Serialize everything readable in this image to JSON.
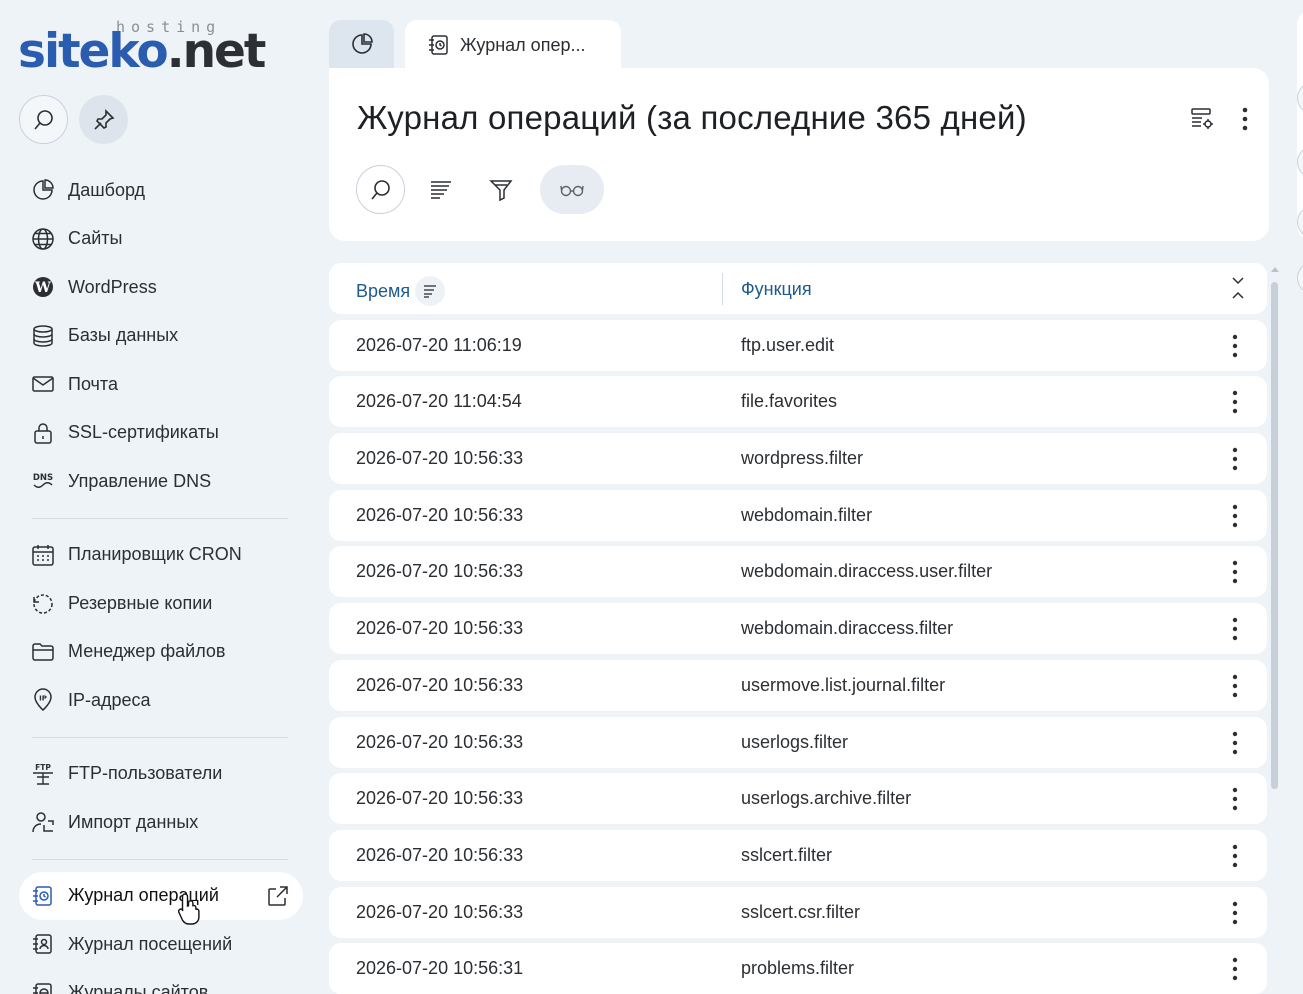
{
  "logo": {
    "hosting": "hosting",
    "brand_main": "siteko",
    "brand_tld": ".net"
  },
  "sidebar": {
    "groups": [
      [
        {
          "label": "Дашборд",
          "icon": "pie-chart-icon"
        },
        {
          "label": "Сайты",
          "icon": "globe-icon"
        },
        {
          "label": "WordPress",
          "icon": "wordpress-icon"
        },
        {
          "label": "Базы данных",
          "icon": "database-icon"
        },
        {
          "label": "Почта",
          "icon": "mail-icon"
        },
        {
          "label": "SSL-сертификаты",
          "icon": "lock-icon"
        },
        {
          "label": "Управление DNS",
          "icon": "dns-icon"
        }
      ],
      [
        {
          "label": "Планировщик CRON",
          "icon": "calendar-icon"
        },
        {
          "label": "Резервные копии",
          "icon": "backup-icon"
        },
        {
          "label": "Менеджер файлов",
          "icon": "folder-icon"
        },
        {
          "label": "IP-адреса",
          "icon": "ip-icon"
        }
      ],
      [
        {
          "label": "FTP-пользователи",
          "icon": "ftp-icon"
        },
        {
          "label": "Импорт данных",
          "icon": "import-icon"
        }
      ],
      [
        {
          "label": "Журнал операций",
          "icon": "journal-icon",
          "active": true
        },
        {
          "label": "Журнал посещений",
          "icon": "visits-journal-icon"
        },
        {
          "label": "Журналы сайтов",
          "icon": "sites-journal-icon"
        }
      ]
    ]
  },
  "tabs": {
    "journal_label": "Журнал опер..."
  },
  "main": {
    "title": "Журнал операций (за последние 365 дней)"
  },
  "table": {
    "columns": {
      "time": "Время",
      "function": "Функция"
    },
    "rows": [
      {
        "time": "2026-07-20 11:06:19",
        "function": "ftp.user.edit"
      },
      {
        "time": "2026-07-20 11:04:54",
        "function": "file.favorites"
      },
      {
        "time": "2026-07-20 10:56:33",
        "function": "wordpress.filter"
      },
      {
        "time": "2026-07-20 10:56:33",
        "function": "webdomain.filter"
      },
      {
        "time": "2026-07-20 10:56:33",
        "function": "webdomain.diraccess.user.filter"
      },
      {
        "time": "2026-07-20 10:56:33",
        "function": "webdomain.diraccess.filter"
      },
      {
        "time": "2026-07-20 10:56:33",
        "function": "usermove.list.journal.filter"
      },
      {
        "time": "2026-07-20 10:56:33",
        "function": "userlogs.filter"
      },
      {
        "time": "2026-07-20 10:56:33",
        "function": "userlogs.archive.filter"
      },
      {
        "time": "2026-07-20 10:56:33",
        "function": "sslcert.filter"
      },
      {
        "time": "2026-07-20 10:56:33",
        "function": "sslcert.csr.filter"
      },
      {
        "time": "2026-07-20 10:56:31",
        "function": "problems.filter"
      }
    ]
  },
  "colors": {
    "accent": "#2a5db0",
    "header_text": "#1f5a8c",
    "background": "#eef3f8"
  }
}
